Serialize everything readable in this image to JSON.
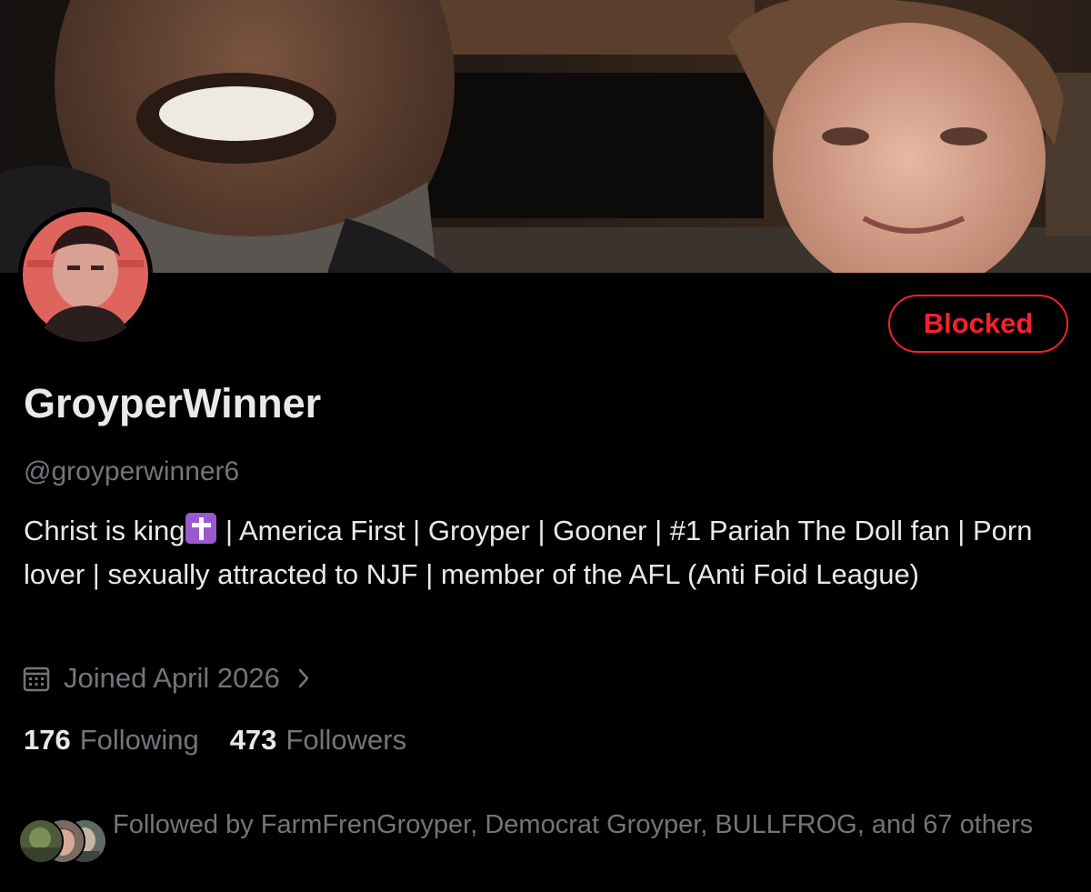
{
  "profile": {
    "display_name": "GroyperWinner",
    "handle": "@groyperwinner6",
    "bio_before_emoji": "Christ is king",
    "bio_emoji": "latin-cross-emoji",
    "bio_after_emoji": " | America First | Groyper | Gooner | #1 Pariah The Doll fan | Porn lover | sexually attracted to NJF | member of the AFL (Anti Foid League)",
    "joined": "Joined April 2026",
    "following_count": "176",
    "following_label": "Following",
    "followers_count": "473",
    "followers_label": "Followers",
    "followed_by": "Followed by FarmFrenGroyper, Democrat Groyper, BULLFROG, and 67 others"
  },
  "actions": {
    "blocked_label": "Blocked"
  },
  "icons": {
    "joined": "calendar-icon",
    "joined_more": "chevron-right-icon"
  },
  "colors": {
    "background": "#000000",
    "primary_text": "#e7e9ea",
    "secondary_text": "#71767b",
    "blocked_red": "#f4212e",
    "emoji_purple": "#9b59d0"
  }
}
